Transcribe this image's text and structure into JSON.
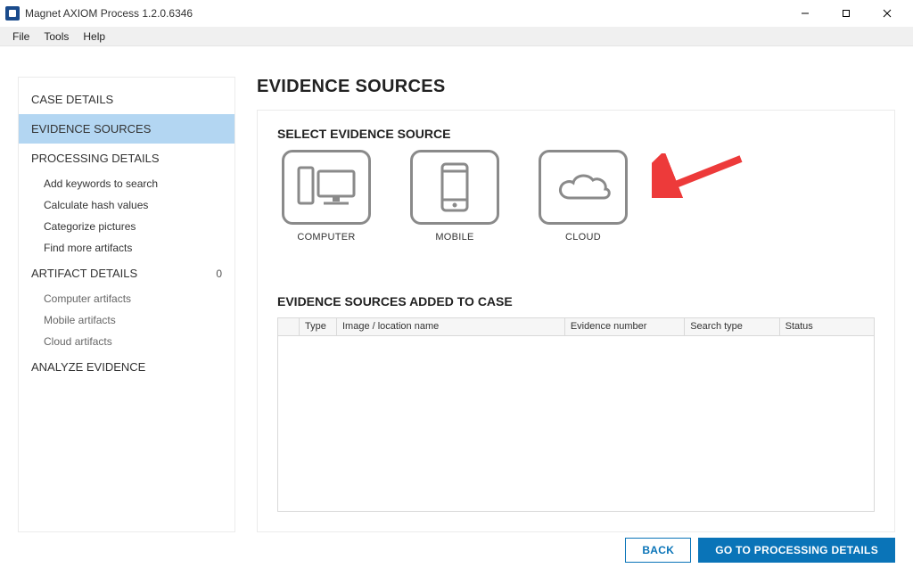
{
  "title": "Magnet AXIOM Process 1.2.0.6346",
  "menu": {
    "file": "File",
    "tools": "Tools",
    "help": "Help"
  },
  "sidebar": {
    "case_details": "CASE DETAILS",
    "evidence_sources": "EVIDENCE SOURCES",
    "processing_details": "PROCESSING DETAILS",
    "processing_subs": {
      "keywords": "Add keywords to search",
      "hash": "Calculate hash values",
      "categorize": "Categorize pictures",
      "more_artifacts": "Find more artifacts"
    },
    "artifact_details": "ARTIFACT DETAILS",
    "artifact_count": "0",
    "artifact_subs": {
      "computer": "Computer artifacts",
      "mobile": "Mobile artifacts",
      "cloud": "Cloud artifacts"
    },
    "analyze_evidence": "ANALYZE EVIDENCE"
  },
  "content": {
    "page_title": "EVIDENCE SOURCES",
    "select_label": "SELECT EVIDENCE SOURCE",
    "sources": {
      "computer": "COMPUTER",
      "mobile": "MOBILE",
      "cloud": "CLOUD"
    },
    "added_label": "EVIDENCE SOURCES ADDED TO CASE",
    "table": {
      "columns": {
        "type": "Type",
        "image": "Image / location name",
        "evidence_no": "Evidence number",
        "search_type": "Search type",
        "status": "Status"
      }
    }
  },
  "footer": {
    "back": "BACK",
    "next": "GO TO PROCESSING DETAILS"
  }
}
